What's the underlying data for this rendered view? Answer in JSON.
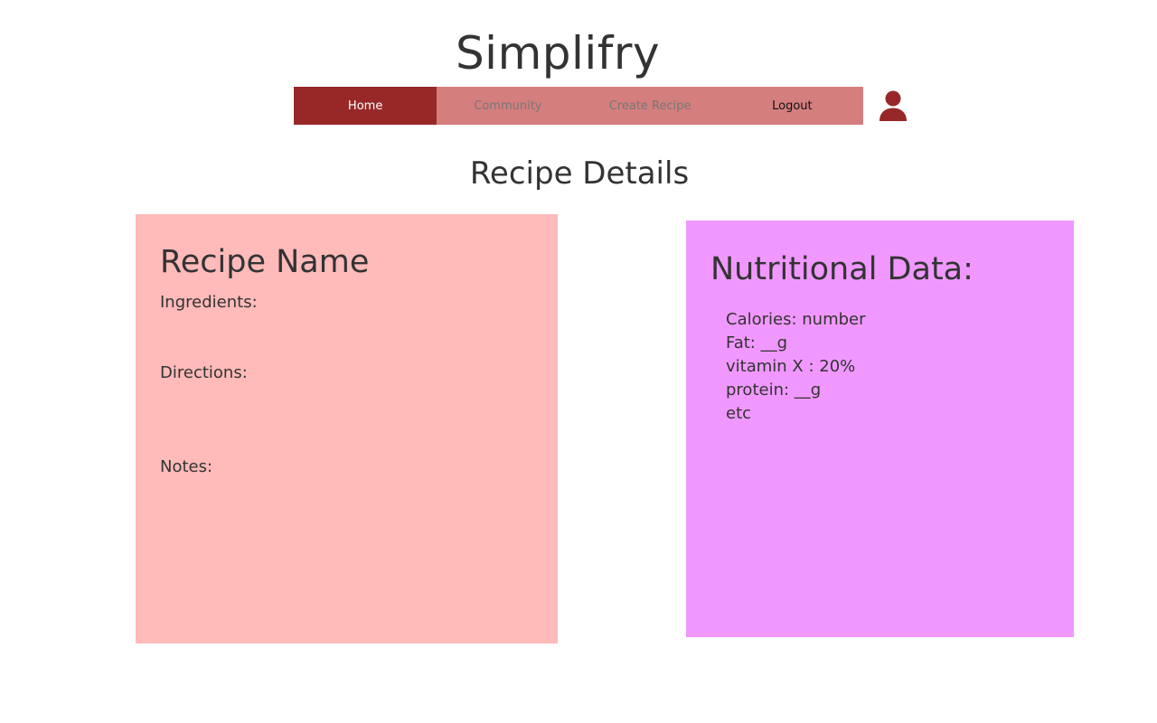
{
  "header": {
    "app_title": "Simplifry"
  },
  "nav": {
    "items": [
      {
        "label": "Home",
        "active": true
      },
      {
        "label": "Community"
      },
      {
        "label": "Create Recipe"
      },
      {
        "label": "Logout"
      }
    ],
    "avatar_icon": "user-icon"
  },
  "page": {
    "title": "Recipe Details"
  },
  "recipe": {
    "name": "Recipe Name",
    "ingredients_label": "Ingredients:",
    "directions_label": "Directions:",
    "notes_label": "Notes:"
  },
  "nutrition": {
    "heading": "Nutritional Data:",
    "items": [
      "Calories: number",
      "Fat: __g",
      "vitamin X : 20%",
      "protein: __g",
      "etc"
    ]
  },
  "colors": {
    "nav_active": "#982828",
    "nav_bar": "#d47e7e",
    "recipe_card": "#ffbaba",
    "nutrition_card": "#f098ff",
    "avatar": "#982828"
  }
}
